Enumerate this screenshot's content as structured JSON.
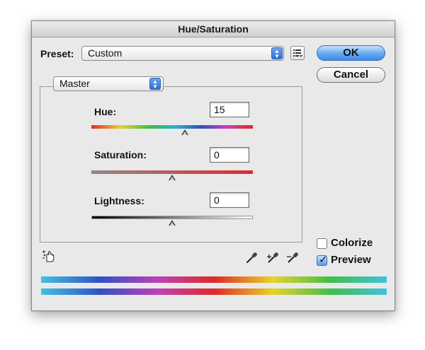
{
  "window": {
    "title": "Hue/Saturation"
  },
  "preset": {
    "label": "Preset:",
    "value": "Custom"
  },
  "buttons": {
    "ok": "OK",
    "cancel": "Cancel"
  },
  "channel": {
    "value": "Master"
  },
  "sliders": [
    {
      "label": "Hue:",
      "value": "15",
      "fraction": 0.58
    },
    {
      "label": "Saturation:",
      "value": "0",
      "fraction": 0.5
    },
    {
      "label": "Lightness:",
      "value": "0",
      "fraction": 0.5
    }
  ],
  "options": {
    "colorize": {
      "label": "Colorize",
      "checked": false
    },
    "preview": {
      "label": "Preview",
      "checked": true
    }
  },
  "icons": {
    "preset_menu": "preset-options-icon",
    "targeted_adjustment": "targeted-adjustment-hand-icon",
    "eyedropper": "eyedropper-icon",
    "add_eyedropper": "add-to-sample-eyedropper-icon",
    "subtract_eyedropper": "subtract-from-sample-eyedropper-icon"
  }
}
